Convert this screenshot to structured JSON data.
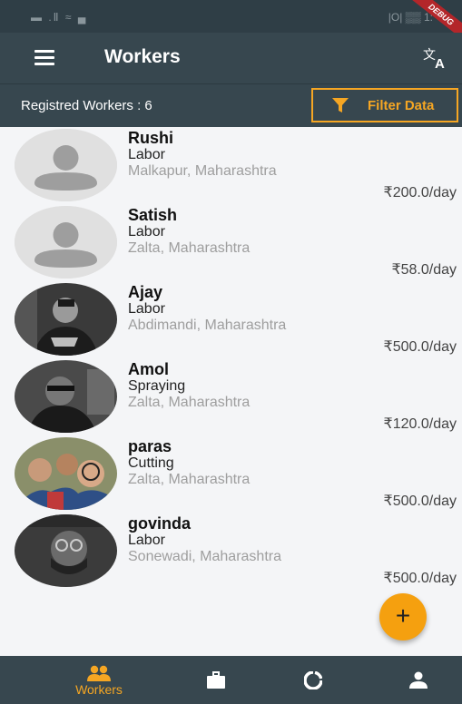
{
  "status_bar": {
    "left": "▬ .Ⅱ ≈ ▄",
    "right": "|O| ▒▒ 1:"
  },
  "debug_label": "DEBUG",
  "app_bar": {
    "title": "Workers",
    "menu_icon": "menu-icon",
    "translate_icon": "translate-icon"
  },
  "filter_bar": {
    "count_label": "Registred Workers : 6",
    "filter_label": "Filter Data",
    "filter_icon": "funnel-icon"
  },
  "workers": [
    {
      "name": "Rushi",
      "work": "Labor",
      "location": "Malkapur, Maharashtra",
      "rate": "₹200.0/day",
      "avatar": "placeholder"
    },
    {
      "name": "Satish",
      "work": "Labor",
      "location": "Zalta, Maharashtra",
      "rate": "₹58.0/day",
      "avatar": "placeholder"
    },
    {
      "name": "Ajay",
      "work": "Labor",
      "location": "Abdimandi, Maharashtra",
      "rate": "₹500.0/day",
      "avatar": "photo"
    },
    {
      "name": "Amol",
      "work": "Spraying",
      "location": "Zalta, Maharashtra",
      "rate": "₹120.0/day",
      "avatar": "photo"
    },
    {
      "name": "paras",
      "work": "Cutting",
      "location": "Zalta, Maharashtra",
      "rate": "₹500.0/day",
      "avatar": "photo"
    },
    {
      "name": "govinda",
      "work": "Labor",
      "location": "Sonewadi, Maharashtra",
      "rate": "₹500.0/day",
      "avatar": "photo"
    }
  ],
  "fab": {
    "label": "+"
  },
  "bottom_nav": [
    {
      "icon": "people-icon",
      "label": "Workers",
      "active": true
    },
    {
      "icon": "briefcase-icon",
      "label": "",
      "active": false
    },
    {
      "icon": "donut-chart-icon",
      "label": "",
      "active": false
    },
    {
      "icon": "person-icon",
      "label": "",
      "active": false
    }
  ],
  "colors": {
    "primary": "#37474f",
    "accent": "#f5a623",
    "background": "#f4f5f7"
  }
}
